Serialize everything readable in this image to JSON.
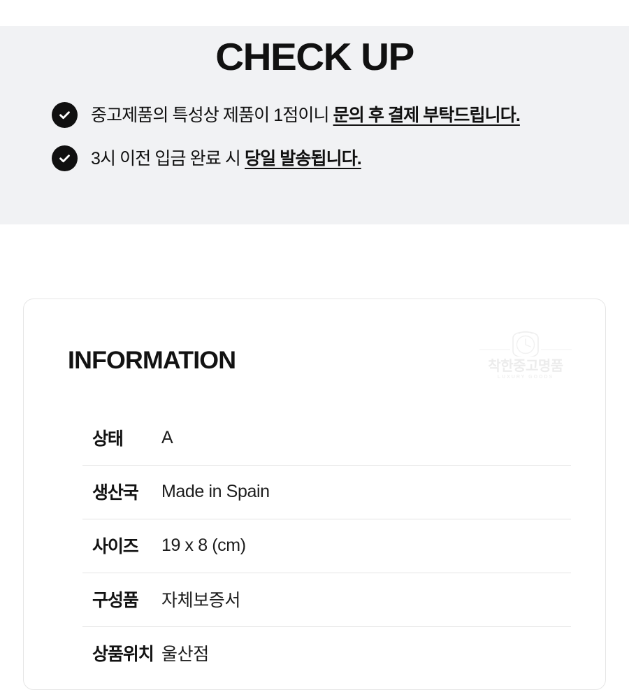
{
  "checkup": {
    "title": "CHECK UP",
    "items": [
      {
        "icon": "check-circle-icon",
        "text_before": "중고제품의 특성상 제품이 1점이니 ",
        "text_highlight": "문의 후 결제 부탁드립니다."
      },
      {
        "icon": "check-circle-icon",
        "text_before": "3시 이전 입금 완료 시 ",
        "text_highlight": "당일 발송됩니다."
      }
    ]
  },
  "information": {
    "title": "INFORMATION",
    "watermark": {
      "icon": "watch-logo-icon",
      "brand": "착한중고명품",
      "tagline": "LUXURY GOODS"
    },
    "rows": [
      {
        "label": "상태",
        "value": "A"
      },
      {
        "label": "생산국",
        "value": "Made in Spain"
      },
      {
        "label": "사이즈",
        "value": "19 x 8 (cm)"
      },
      {
        "label": "구성품",
        "value": "자체보증서"
      },
      {
        "label": "상품위치",
        "value": "울산점"
      }
    ]
  },
  "colors": {
    "panel_bg": "#f1f2f4",
    "page_bg": "#ffffff",
    "text": "#111111",
    "icon_bg": "#101010",
    "card_border": "#e6e6e6",
    "divider": "#e4e4e4",
    "watermark": "#ececec"
  }
}
